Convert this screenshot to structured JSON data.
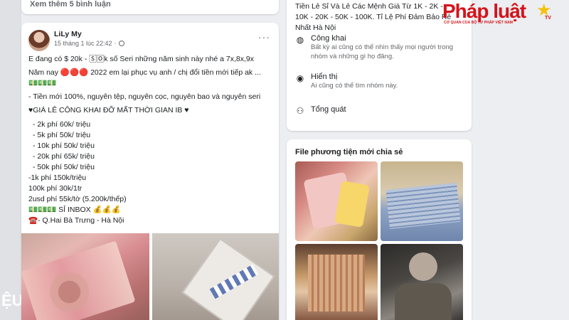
{
  "comments": {
    "more_label": "Xem thêm 5 bình luận"
  },
  "post": {
    "author": "LiLy My",
    "timestamp": "15 tháng 1 lúc 22:42",
    "privacy_dot": "·",
    "lines": [
      "E đang có $ 20k - 🅂🄾k số Seri những năm sinh này nhé a 7x,8x,9x",
      "Năm nay 🔴🔴🔴 2022 em lại phục vụ anh / chị đổi tiền mới tiếp ak ...",
      "💵💵💵",
      "- Tiền mới 100%, nguyên tệp, nguyên cọc, nguyên bao và nguyên seri",
      "♥GIÁ LẺ CÔNG KHAI ĐỠ MẤT THỜI GIAN IB ♥",
      "- 2k phí 60k/ triệu",
      "- 5k phí 50k/ triệu",
      "- 10k phí 50k/ triệu",
      "- 20k phí 65k/ triệu",
      "- 50k phí 50k/ triệu",
      "-1k phí 150k/triệu",
      "100k phí 30k/1tr",
      "2usd phí 55k/tờ (5.200k/thếp)",
      "💵💵💵 SỈ INBOX 💰💰💰",
      "☎️- Q.Hai Bà Trưng - Hà Nội"
    ]
  },
  "about": {
    "intro_lines": [
      "Tiền Lẻ Sỉ Và Lẻ Các Mệnh Giá Từ 1K - 2K -",
      "10K - 20K - 50K - 100K. Tỉ Lệ Phí Đảm Bảo Rẻ",
      "Nhất Hà Nội"
    ],
    "public_title": "Công khai",
    "public_desc": "Bất kỳ ai cũng có thể nhìn thấy mọi người trong nhóm và những gì họ đăng.",
    "visible_title": "Hiển thị",
    "visible_desc": "Ai cũng có thể tìm nhóm này.",
    "overview_title": "Tổng quát"
  },
  "media": {
    "title": "File phương tiện mới chia sẻ"
  },
  "watermark": {
    "brand": "Pháp luật",
    "tv": "TV",
    "tagline": "CƠ QUAN CỦA BỘ TƯ PHÁP VIỆT NAM"
  },
  "edge_text": "ỆU",
  "icons": {
    "globe": "globe-icon",
    "more": "more-options-icon",
    "public": "globe-public-icon",
    "visible": "eye-icon",
    "overview": "people-icon",
    "star": "star-icon"
  },
  "colors": {
    "brand_red": "#d4141b",
    "star_yellow": "#f4c20d",
    "heart_red": "#e02424"
  }
}
